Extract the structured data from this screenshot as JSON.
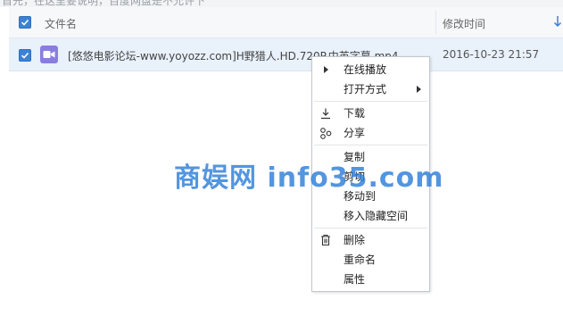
{
  "top_hint": "首先，在这里要说明，百度网盘是不允许下",
  "columns": {
    "name": "文件名",
    "modified": "修改时间"
  },
  "file": {
    "name": "[悠悠电影论坛-www.yoyozz.com]H野猎人.HD.720P.中英字幕.mp4",
    "modified": "2016-10-23 21:57",
    "selected": true
  },
  "context_menu": {
    "items": [
      {
        "label": "在线播放",
        "icon": "play-icon"
      },
      {
        "label": "打开方式",
        "icon": "",
        "submenu": true
      },
      {
        "label": "下载",
        "icon": "download-icon"
      },
      {
        "label": "分享",
        "icon": "share-icon"
      },
      {
        "label": "复制",
        "icon": ""
      },
      {
        "label": "剪切",
        "icon": ""
      },
      {
        "label": "移动到",
        "icon": ""
      },
      {
        "label": "移入隐藏空间",
        "icon": ""
      },
      {
        "label": "删除",
        "icon": "trash-icon"
      },
      {
        "label": "重命名",
        "icon": ""
      },
      {
        "label": "属性",
        "icon": ""
      }
    ]
  },
  "watermark": "商娱网 info35.com",
  "colors": {
    "accent": "#3b82d6",
    "row_selected": "#e9f1fb",
    "file_icon": "#8a7de0",
    "watermark": "#2e7ed8"
  }
}
